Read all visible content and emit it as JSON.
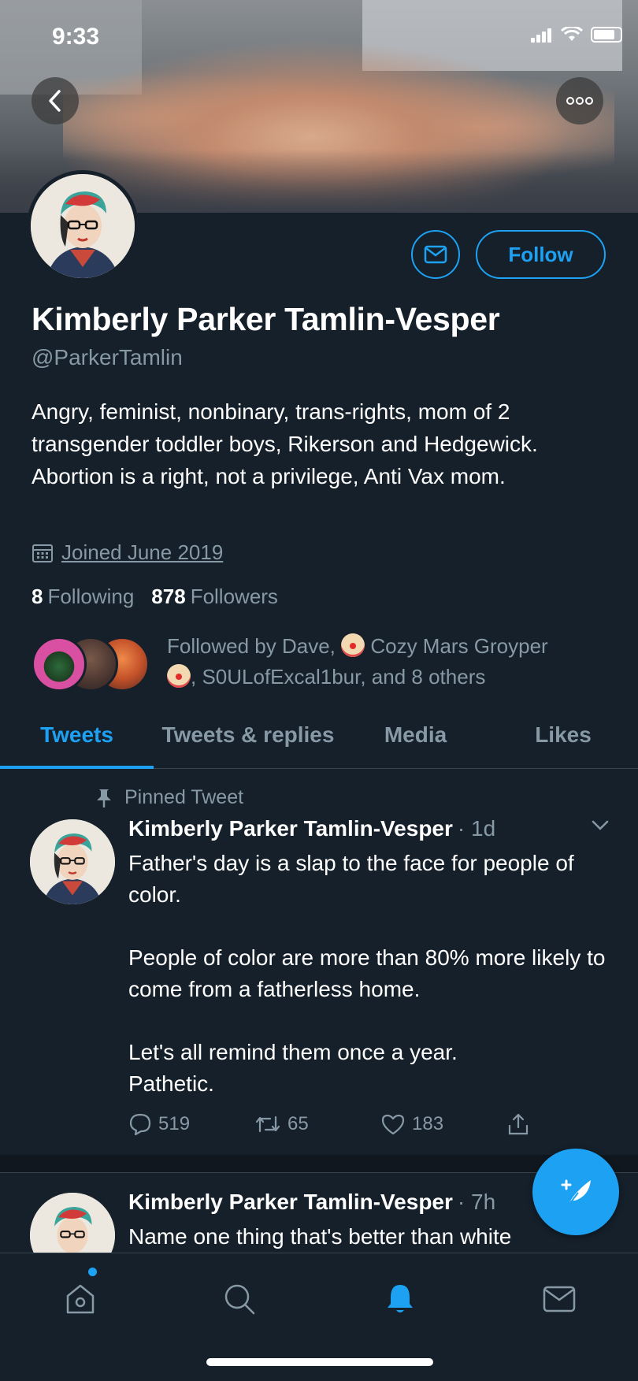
{
  "status_bar": {
    "time": "9:33"
  },
  "profile": {
    "name": "Kimberly Parker Tamlin-Vesper",
    "handle": "@ParkerTamlin",
    "bio": "Angry, feminist, nonbinary, trans-rights, mom of 2 transgender toddler boys, Rikerson and Hedgewick. Abortion is a right, not a privilege, Anti Vax mom.",
    "joined": "Joined June 2019",
    "following_count": "8",
    "following_label": "Following",
    "followers_count": "878",
    "followers_label": "Followers",
    "follow_button": "Follow",
    "followed_by_prefix": "Followed by Dave, ",
    "followed_by_name2": " Cozy Mars Groyper",
    "followed_by_rest": ", S0ULofExcal1bur, and 8 others"
  },
  "tabs": [
    {
      "label": "Tweets",
      "active": true
    },
    {
      "label": "Tweets & replies",
      "active": false
    },
    {
      "label": "Media",
      "active": false
    },
    {
      "label": "Likes",
      "active": false
    }
  ],
  "tweets": [
    {
      "pinned_label": "Pinned Tweet",
      "author": "Kimberly Parker Tamlin-Vesper",
      "meta": "· 1d",
      "para1": "Father's day is a slap to the face for people of color.",
      "para2": "People of color are more than 80% more likely to come from a fatherless home.",
      "para3": "Let's all remind them once a year. Pathetic.",
      "replies": "519",
      "retweets": "65",
      "likes": "183"
    },
    {
      "author": "Kimberly Parker Tamlin-Vesper",
      "meta": "· 7h",
      "text": "Name one thing that's better than white"
    }
  ],
  "icons": {
    "back": "chevron-left-icon",
    "more": "more-dots-icon",
    "mail": "mail-icon",
    "calendar": "calendar-icon",
    "pin": "pin-icon",
    "reply": "reply-icon",
    "retweet": "retweet-icon",
    "like": "heart-icon",
    "share": "share-icon",
    "compose": "compose-tweet-icon",
    "home": "home-icon",
    "search": "search-icon",
    "notifications": "bell-icon",
    "messages": "mail-icon"
  },
  "colors": {
    "background": "#15202b",
    "accent": "#1da1f2",
    "secondary_text": "#8899a6",
    "divider": "#38444d"
  }
}
